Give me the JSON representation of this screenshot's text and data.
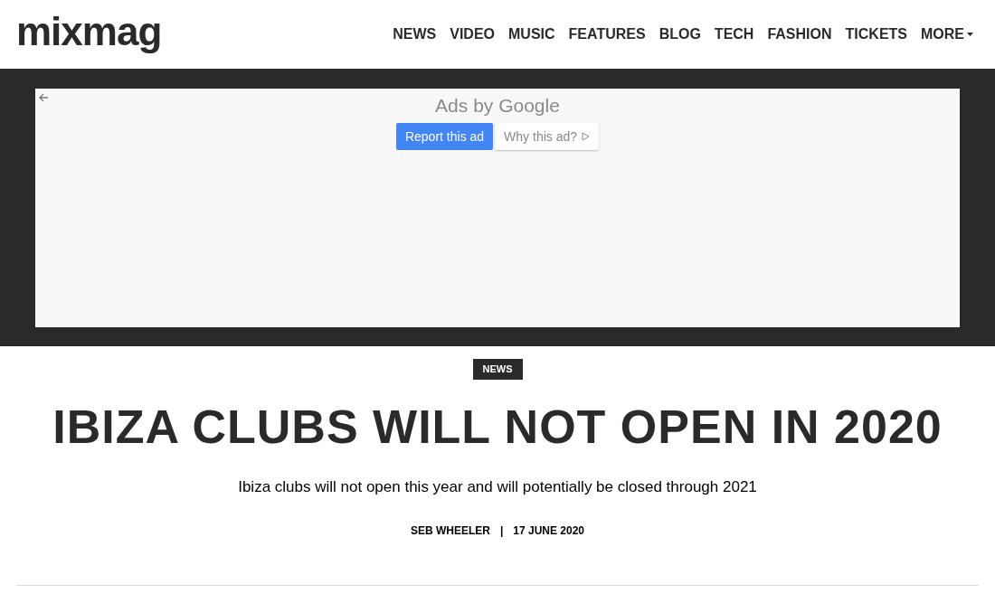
{
  "header": {
    "logo": "mixmag",
    "nav": [
      {
        "label": "NEWS"
      },
      {
        "label": "VIDEO"
      },
      {
        "label": "MUSIC"
      },
      {
        "label": "FEATURES"
      },
      {
        "label": "BLOG"
      },
      {
        "label": "TECH"
      },
      {
        "label": "FASHION"
      },
      {
        "label": "TICKETS"
      },
      {
        "label": "MORE",
        "dropdown": true
      }
    ]
  },
  "ad": {
    "title": "Ads by Google",
    "report_button": "Report this ad",
    "why_button": "Why this ad?"
  },
  "article": {
    "category": "NEWS",
    "headline": "IBIZA CLUBS WILL NOT OPEN IN 2020",
    "standfirst": "Ibiza clubs will not open this year and will potentially be closed through 2021",
    "author": "SEB WHEELER",
    "separator": "|",
    "date": "17 JUNE 2020"
  }
}
